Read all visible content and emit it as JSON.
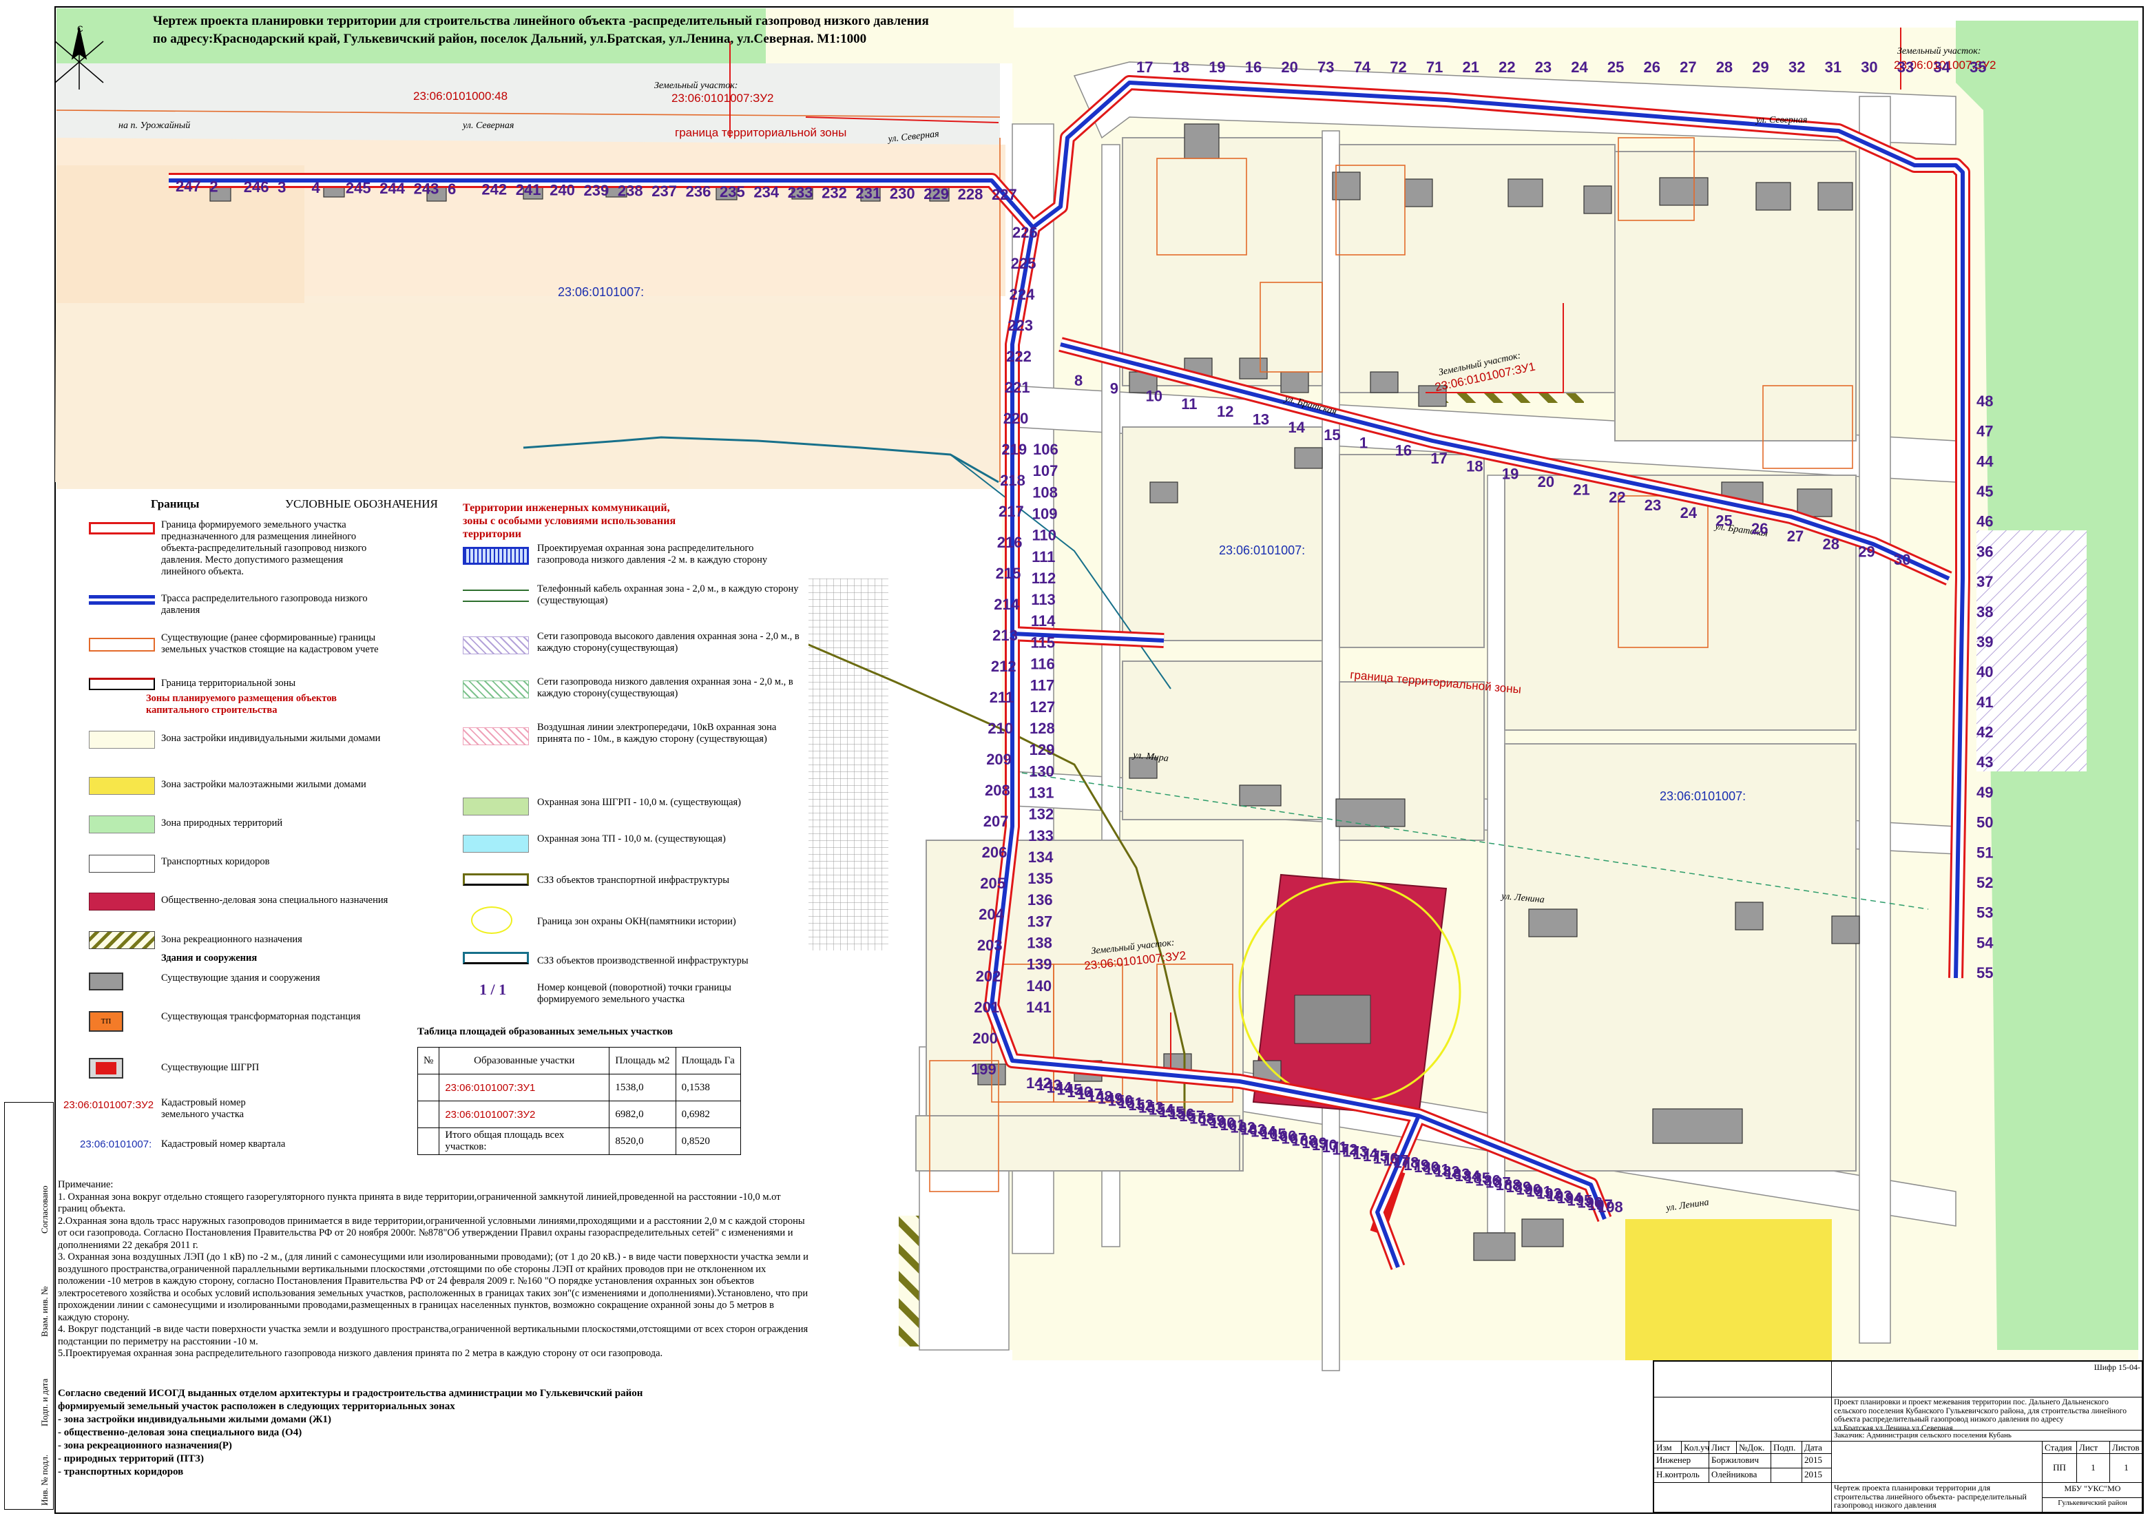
{
  "header": {
    "title_line1": "Чертеж проекта планировки территории  для  строительства линейного объекта -распределительный газопровод низкого давления",
    "title_line2": "по адресу:Краснодарский край, Гулькевичский район, поселок Дальний, ул.Братская, ул.Ленина, ул.Северная.   М1:1000"
  },
  "map": {
    "north_label": "С",
    "quarter_labels": [
      "23:06:0101007:",
      "23:06:0101007:",
      "23:06:0101007:"
    ],
    "quarter_west": "23:06:0101007:",
    "parcel_north_code": "23:06:0101000:48",
    "parcel_zu2_caption": "Земельный участок:",
    "parcel_zu2_code": "23:06:0101007:ЗУ2",
    "parcel_zu2b_caption": "Земельный участок:",
    "parcel_zu2b_code": "23:06:0101007:ЗУ2",
    "parcel_zu1_caption": "Земельный участок:",
    "parcel_zu1_code": "23:06:0101007:ЗУ1",
    "parcel_zu2c_caption": "Земельный участок:",
    "parcel_zu2c_code": "23:06:0101007:ЗУ2",
    "zone_border_label": "граница территориальной зоны",
    "zone_border_label2": "граница территориальной зоны",
    "streets": {
      "severnaya1": "ул. Северная",
      "severnaya2": "ул. Северная",
      "severnaya3": "ул. Северная",
      "uroch": "на п. Урожайный",
      "bratskaya": "ул. Братская",
      "bratskaya2": "ул. Братская",
      "lenina": "ул. Ленина",
      "lenina2": "ул. Ленина",
      "mira": "ул. Мира"
    },
    "point_labels": {
      "top_row": [
        "17",
        "18",
        "19",
        "16",
        "20",
        "73",
        "74",
        "72",
        "71",
        "21",
        "22",
        "23",
        "24",
        "25",
        "26",
        "27",
        "28",
        "29",
        "32",
        "31",
        "30",
        "33",
        "34",
        "35"
      ],
      "west_row": [
        "247",
        "2",
        "246",
        "3",
        "4",
        "245",
        "244",
        "243",
        "6",
        "242",
        "241",
        "240",
        "239",
        "238",
        "237",
        "236",
        "235",
        "234",
        "233",
        "232",
        "231",
        "230",
        "229",
        "228",
        "227"
      ],
      "mid_block": [
        "48",
        "47",
        "44",
        "45",
        "46",
        "36",
        "37",
        "38",
        "39",
        "40",
        "41",
        "42",
        "43",
        "49",
        "50",
        "51",
        "52",
        "53",
        "54",
        "55"
      ],
      "inner_block": [
        "8",
        "9",
        "10",
        "11",
        "12",
        "13",
        "14",
        "15",
        "1",
        "16",
        "17",
        "18",
        "19",
        "20",
        "21",
        "22",
        "23",
        "24",
        "25",
        "26",
        "27",
        "28",
        "29",
        "30"
      ],
      "west_column": [
        "226",
        "225",
        "224",
        "223",
        "222",
        "221",
        "220",
        "219",
        "218",
        "217",
        "216",
        "215",
        "214",
        "213",
        "212",
        "211",
        "210",
        "209",
        "208",
        "207",
        "206",
        "205",
        "204",
        "203",
        "202",
        "201",
        "200",
        "199"
      ],
      "mid_column": [
        "106",
        "107",
        "108",
        "109",
        "110",
        "111",
        "112",
        "113",
        "114",
        "115",
        "116",
        "117",
        "127",
        "128",
        "129",
        "130",
        "131",
        "132",
        "133",
        "134",
        "135",
        "136",
        "137",
        "138",
        "139",
        "140",
        "141"
      ],
      "south_row": [
        "142",
        "143",
        "144",
        "145",
        "146",
        "147",
        "148",
        "149",
        "150",
        "151",
        "152",
        "153",
        "154",
        "155",
        "156",
        "157",
        "158",
        "159",
        "160",
        "161",
        "162",
        "163",
        "164",
        "165",
        "166",
        "167",
        "168",
        "169",
        "170",
        "171",
        "172",
        "173",
        "174",
        "175",
        "176",
        "177",
        "178",
        "179",
        "180",
        "181",
        "182",
        "183",
        "184",
        "185",
        "186",
        "187",
        "188",
        "189",
        "190",
        "191",
        "192",
        "193",
        "194",
        "195",
        "196",
        "197",
        "198"
      ]
    }
  },
  "legend": {
    "heading_borders": "Границы",
    "heading_conventions": "УСЛОВНЫЕ ОБОЗНАЧЕНИЯ",
    "items_left": [
      "Граница формируемого земельного участка предназначенного для размещения линейного объекта-распределительный газопровод низкого давления. Место допустимого размещения линейного объекта.",
      "Трасса распределительного газопровода низкого давления",
      "Существующие (ранее сформированные) границы земельных участков стоящие на кадастровом учете",
      "Граница территориальной зоны"
    ],
    "zones_heading": "Зоны планируемого размещения объектов капитального строительства",
    "zones": [
      "Зона застройки индивидуальными жилыми домами",
      "Зона застройки малоэтажными жилыми домами",
      "Зона природных территорий",
      "Транспортных коридоров",
      "Общественно-деловая зона специального назначения",
      "Зона рекреационного назначения"
    ],
    "buildings_heading": "Здания и сооружения",
    "buildings": [
      "Существующие здания и сооружения",
      "Существующая трансформаторная подстанция",
      "Существующие ШГРП"
    ],
    "tp_label": "ТП",
    "cad_parcel_example": "23:06:0101007:ЗУ2",
    "cad_parcel_text": "Кадастровый  номер земельного участка",
    "cad_quarter_example": "23:06:0101007:",
    "cad_quarter_text": "Кадастровый номер квартала",
    "right_heading": "Территории инженерных коммуникаций, зоны с особыми условиями использования территории",
    "right_items": [
      "Проектируемая охранная зона распределительного газопровода низкого давления -2 м. в каждую сторону",
      "Телефонный кабель охранная зона - 2,0 м., в каждую сторону (существующая)",
      "Сети газопровода высокого давления охранная зона - 2,0 м., в каждую сторону(существующая)",
      "Сети газопровода низкого давления охранная зона - 2,0 м., в каждую сторону(существующая)",
      "Воздушная линии электропередачи, 10кВ охранная зона принята по - 10м., в каждую сторону (существующая)",
      "Охранная зона ШГРП - 10,0 м. (существующая)",
      "Охранная зона ТП - 10,0 м. (существующая)",
      "СЗЗ объектов транспортной инфраструктуры",
      "Граница зон охраны ОКН(памятники истории)",
      "СЗЗ объектов производственной инфраструктуры",
      "Номер концевой (поворотной) точки границы формируемого земельного участка"
    ],
    "point_example": "1 / 1"
  },
  "area_table": {
    "title": "Таблица площадей образованных земельных участков",
    "headers": [
      "№",
      "Образованные участки",
      "Площадь м2",
      "Площадь Га"
    ],
    "rows": [
      [
        "",
        "23:06:0101007:ЗУ1",
        "1538,0",
        "0,1538"
      ],
      [
        "",
        "23:06:0101007:ЗУ2",
        "6982,0",
        "0,6982"
      ],
      [
        "",
        "Итого общая площадь всех участков:",
        "8520,0",
        "0,8520"
      ]
    ]
  },
  "notes": {
    "heading": "Примечание:",
    "lines": [
      "1. Охранная зона вокруг отдельно стоящего газорегуляторного пункта принята в виде территории,ограниченной замкнутой линией,проведенной на расстоянии -10,0 м.от границ объекта.",
      "2.Охранная зона вдоль трасс наружных газопроводов принимается в виде территории,ограниченной условными линиями,проходящими и а расстоянии 2,0 м с каждой стороны от оси газопровода. Согласно Постановления Правительства РФ от 20 ноября 2000г. №878\"Об утверждении Правил охраны газораспределительных сетей\" с изменениями и дополнениями 22 декабря 2011 г.",
      "3. Охранная зона воздушных ЛЭП (до 1 кВ) по -2 м., (для линий с самонесущими или изолированными проводами); (от 1 до 20 кВ.) - в виде части поверхности участка земли и воздушного пространства,ограниченной параллельными вертикальными плоскостями ,отстоящими по обе стороны ЛЭП от крайних проводов при не отклоненном их положении -10 метров в каждую сторону, согласно Постановления Правительства РФ от 24 февраля 2009 г. №160 \"О порядке установления охранных зон объектов электросетевого хозяйства и особых условий использования земельных участков, расположенных в границах таких зон\"(с изменениями и дополнениями).Установлено, что при прохождении линии с самонесущими и изолированными проводами,размещенных в границах населенных пунктов, возможно сокращение охранной зоны до 5 метров в каждую сторону.",
      "4. Вокруг подстанций -в виде части поверхности участка земли и воздушного пространства,ограниченной вертикальными плоскостями,отстоящими от всех сторон ограждения подстанции по периметру на расстоянии -10 м.",
      "5.Проектируемая охранная зона распределительного газопровода низкого давления  принята  по 2 метра в каждую сторону от оси газопровода."
    ]
  },
  "isogd": {
    "lines": [
      "Согласно сведений ИСОГД  выданных отделом архитектуры и градостроительства администрации мо Гулькевичский район",
      "формируемый земельный участок расположен в следующих территориальных зонах",
      "- зона застройки индивидуальными жилыми домами (Ж1)",
      "- общественно-деловая зона специального вида (О4)",
      "- зона рекреационного назначения(Р)",
      "- природных территорий (ПТЗ)",
      "- транспортных коридоров"
    ]
  },
  "stamp": {
    "code": "Шифр 15-04-",
    "project_desc": "Проект планировки и проект межевания территории пос. Дальнего Дальненского сельского поселения Кубанского Гулькевичского района, для строительства линейного объекта распределительный газопровод низкого давления по адресу ул.Братская,ул.Ленина,ул.Северная",
    "client": "Заказчик: Администрация сельского поселения Кубань",
    "cols": [
      "Изм",
      "Кол.уч",
      "Лист",
      "№Док.",
      "Подп.",
      "Дата"
    ],
    "stage_head": [
      "Стадия",
      "Лист",
      "Листов"
    ],
    "stage_vals": [
      "ПП",
      "1",
      "1"
    ],
    "engineer_role": "Инженер",
    "engineer_name": "Боржилович",
    "engineer_date": "2015",
    "control_role": "Н.контроль",
    "control_name": "Олейникова",
    "control_date": "2015",
    "drawing_title": "Чертеж  проекта  планировки  территории для  строительства линейного объекта- распределительный газопровод низкого давления",
    "org_name": "МБУ \"УКС\"МО",
    "org_district": "Гулькевичский район"
  },
  "side_stamp": [
    "Согласовано",
    "Взам. инв. №",
    "Подп. и дата",
    "Инв. № подл."
  ],
  "colors": {
    "pipe_blue": "#1a32c8",
    "parcel_red": "#e01818",
    "purple_numbers": "#4b1d8c",
    "public_zone": "#c8214a",
    "green_zone": "#b8ecb0",
    "residential": "#fdfce6",
    "recreation": "#6b6b10",
    "yellow_zone": "#f7e64a"
  }
}
